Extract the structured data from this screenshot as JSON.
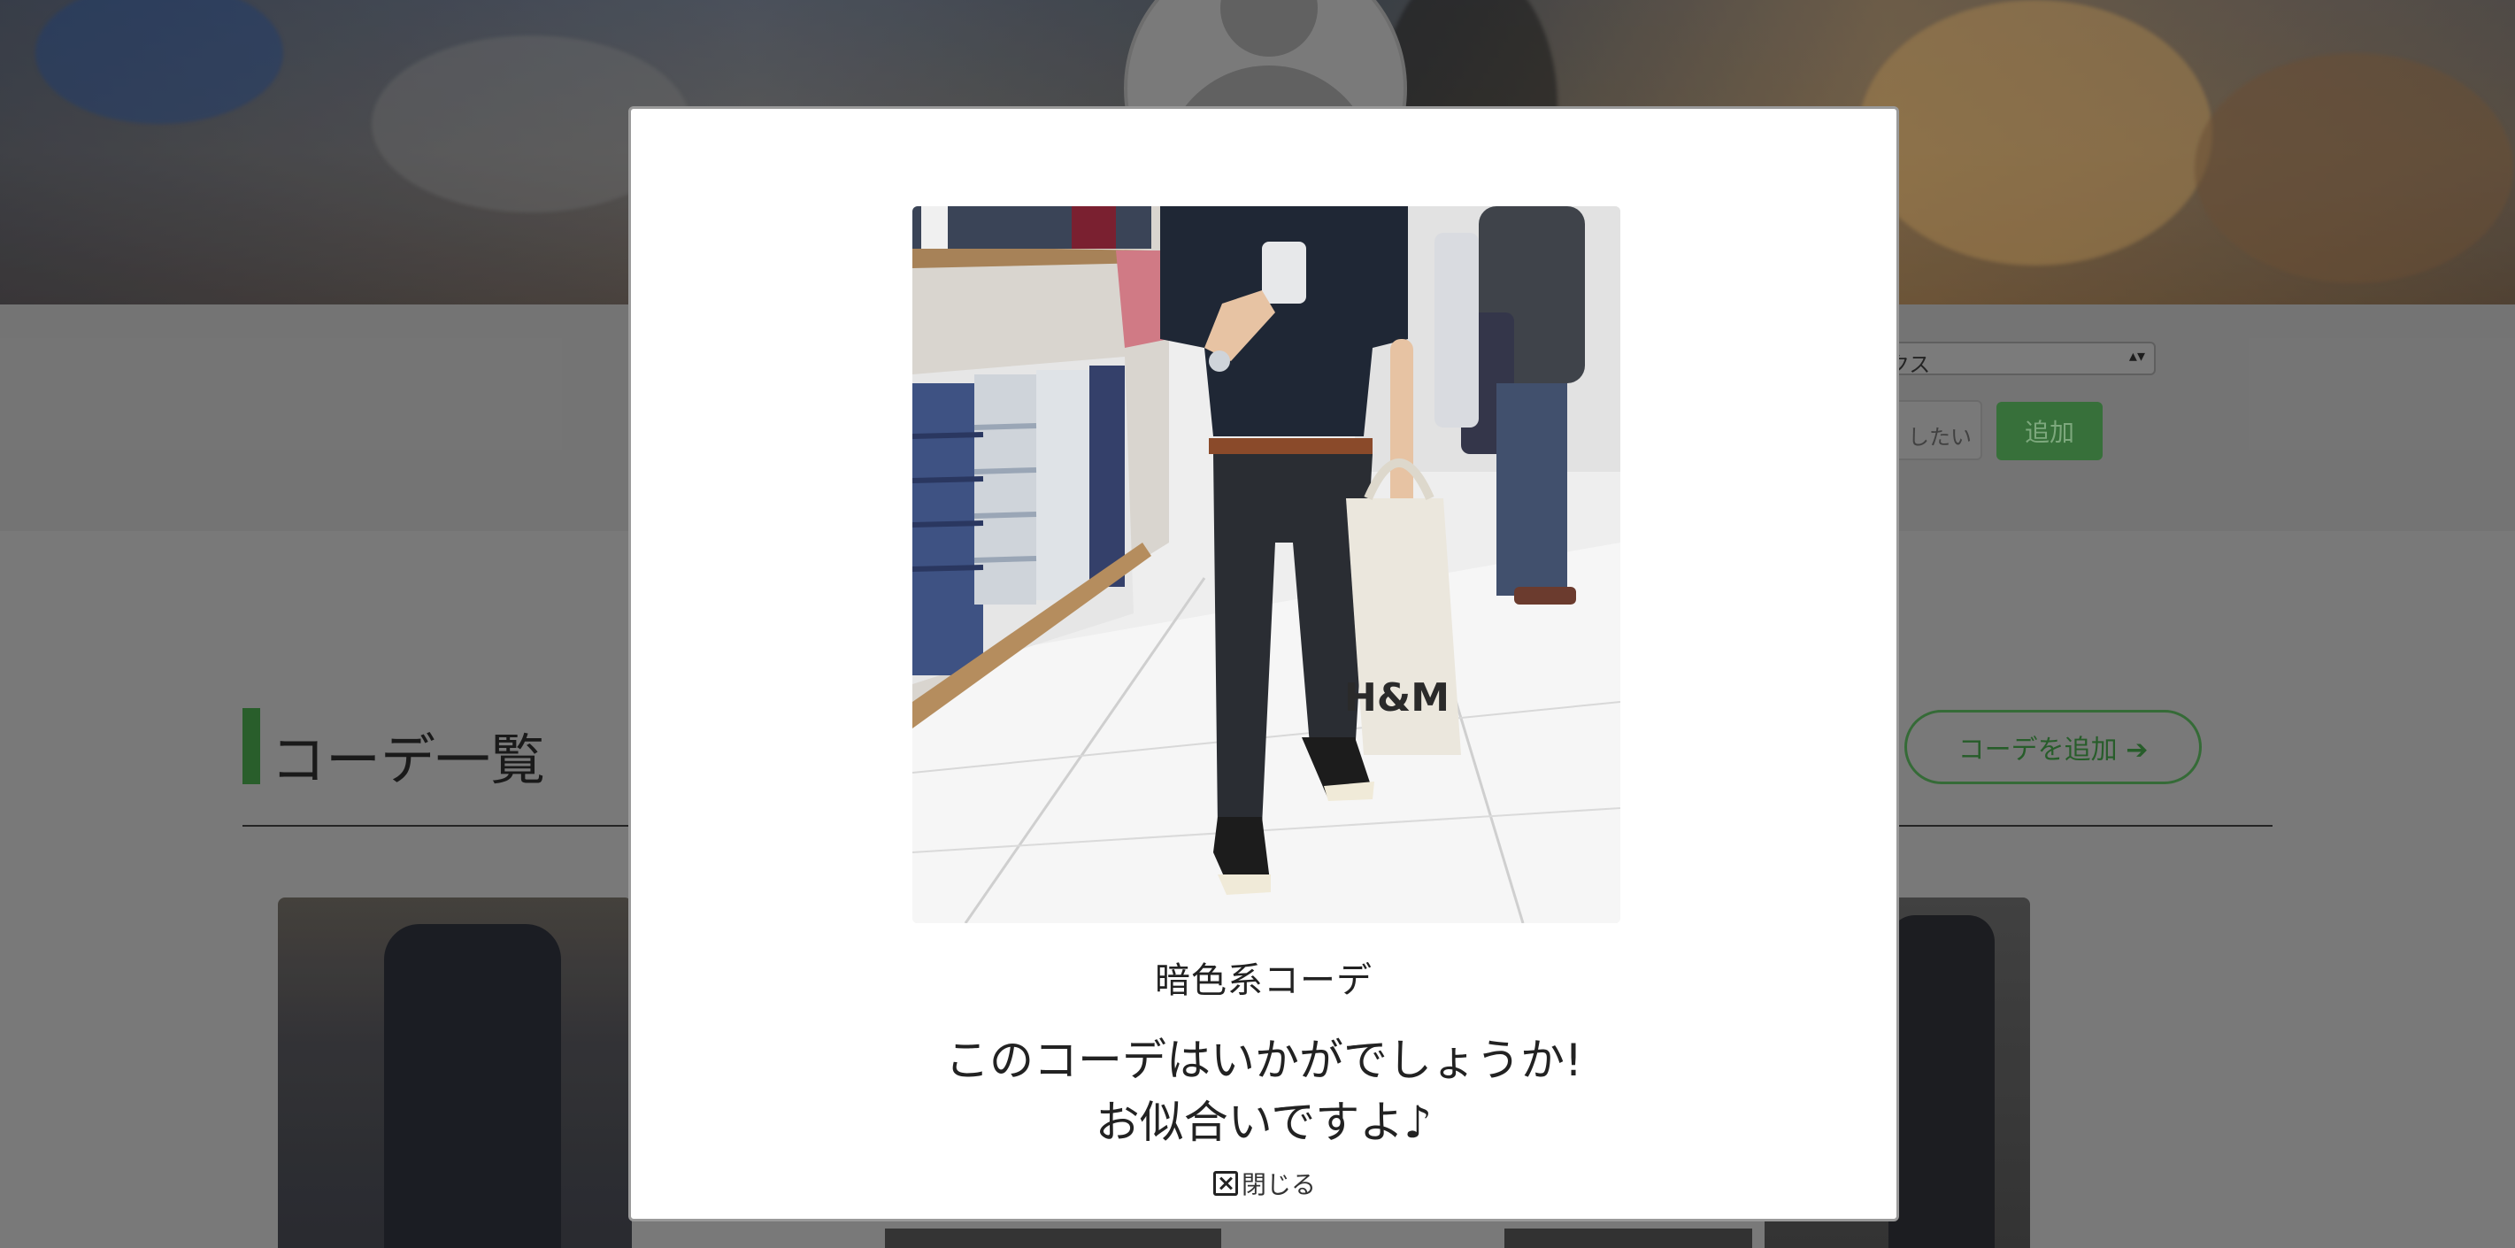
{
  "background": {
    "category_select": {
      "value": "ラックス",
      "arrow": "▴▾"
    },
    "wish_field": {
      "placeholder": "したい"
    },
    "add_button": {
      "label": "追加"
    },
    "section": {
      "title": "コーデ一覧"
    },
    "add_coordinate_button": {
      "label": "コーデを追加 ➔"
    }
  },
  "modal": {
    "photo": {
      "bag_text": "H&M"
    },
    "coordinate_name": "暗色系コーデ",
    "message_lines": [
      "このコーデはいかがでしょうか!",
      "お似合いですよ♪"
    ],
    "close_button": {
      "label": "閉じる"
    }
  },
  "colors": {
    "accent_green": "#2f6b32",
    "modal_background": "#ffffff"
  }
}
